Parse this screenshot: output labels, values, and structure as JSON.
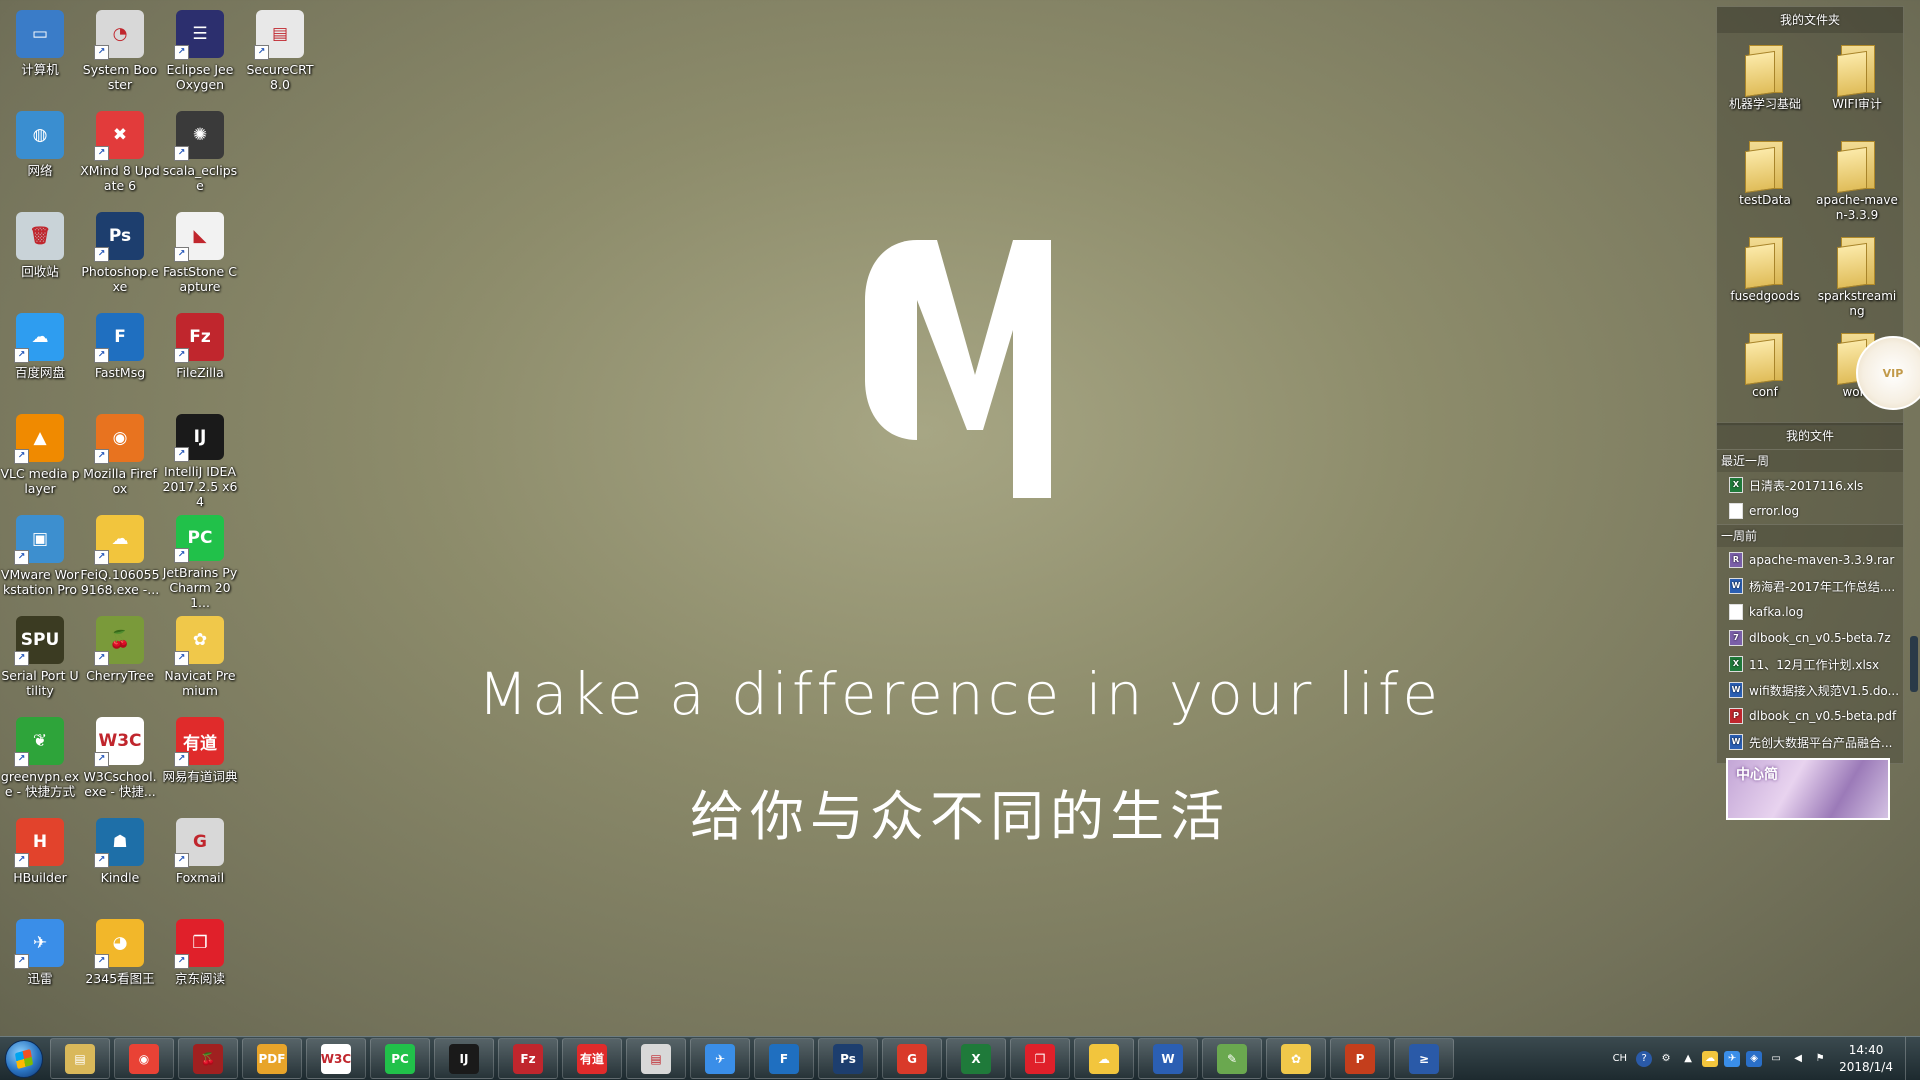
{
  "desktop": {
    "icons": [
      {
        "label": "计算机",
        "icon": "computer-icon",
        "bg": "#3a7cc8",
        "glyph": "▭",
        "shortcut": false
      },
      {
        "label": "System Booster",
        "icon": "system-booster-icon",
        "bg": "#d8d8d8",
        "glyph": "◔",
        "shortcut": true
      },
      {
        "label": "Eclipse Jee Oxygen",
        "icon": "eclipse-icon",
        "bg": "#2c2f6e",
        "glyph": "☰",
        "shortcut": true
      },
      {
        "label": "SecureCRT 8.0",
        "icon": "securecrt-icon",
        "bg": "#e8e8e8",
        "glyph": "▤",
        "shortcut": true
      },
      {
        "label": "网络",
        "icon": "network-icon",
        "bg": "#3a8ed0",
        "glyph": "◍",
        "shortcut": false
      },
      {
        "label": "XMind 8 Update 6",
        "icon": "xmind-icon",
        "bg": "#e23b3b",
        "glyph": "✖",
        "shortcut": true
      },
      {
        "label": "scala_eclipse",
        "icon": "scala-eclipse-icon",
        "bg": "#3a3a3a",
        "glyph": "✺",
        "shortcut": true
      },
      {
        "label": "",
        "icon": "",
        "bg": "",
        "glyph": "",
        "shortcut": false
      },
      {
        "label": "回收站",
        "icon": "recycle-bin-icon",
        "bg": "#c9d3d8",
        "glyph": "🗑",
        "shortcut": false
      },
      {
        "label": "Photoshop.exe",
        "icon": "photoshop-icon",
        "bg": "#1d3e6e",
        "glyph": "Ps",
        "shortcut": true
      },
      {
        "label": "FastStone Capture",
        "icon": "faststone-icon",
        "bg": "#f2f2f2",
        "glyph": "◣",
        "shortcut": true
      },
      {
        "label": "",
        "icon": "",
        "bg": "",
        "glyph": "",
        "shortcut": false
      },
      {
        "label": "百度网盘",
        "icon": "baidu-netdisk-icon",
        "bg": "#2e9df0",
        "glyph": "☁",
        "shortcut": true
      },
      {
        "label": "FastMsg",
        "icon": "fastmsg-icon",
        "bg": "#1f6fc0",
        "glyph": "F",
        "shortcut": true
      },
      {
        "label": "FileZilla",
        "icon": "filezilla-icon",
        "bg": "#c0262d",
        "glyph": "Fz",
        "shortcut": true
      },
      {
        "label": "",
        "icon": "",
        "bg": "",
        "glyph": "",
        "shortcut": false
      },
      {
        "label": "VLC media player",
        "icon": "vlc-icon",
        "bg": "#f08a00",
        "glyph": "▲",
        "shortcut": true
      },
      {
        "label": "Mozilla Firefox",
        "icon": "firefox-icon",
        "bg": "#e8731f",
        "glyph": "◉",
        "shortcut": true
      },
      {
        "label": "IntelliJ IDEA 2017.2.5 x64",
        "icon": "intellij-icon",
        "bg": "#1a1a1a",
        "glyph": "IJ",
        "shortcut": true
      },
      {
        "label": "",
        "icon": "",
        "bg": "",
        "glyph": "",
        "shortcut": false
      },
      {
        "label": "VMware Workstation Pro",
        "icon": "vmware-icon",
        "bg": "#3d8fcf",
        "glyph": "▣",
        "shortcut": true
      },
      {
        "label": "FeiQ.1060559168.exe -...",
        "icon": "feiq-icon",
        "bg": "#f2c53d",
        "glyph": "☁",
        "shortcut": true
      },
      {
        "label": "JetBrains PyCharm 201...",
        "icon": "pycharm-icon",
        "bg": "#21c14a",
        "glyph": "PC",
        "shortcut": true
      },
      {
        "label": "",
        "icon": "",
        "bg": "",
        "glyph": "",
        "shortcut": false
      },
      {
        "label": "Serial Port Utility",
        "icon": "serial-port-utility-icon",
        "bg": "#3b3b22",
        "glyph": "SPU",
        "shortcut": true
      },
      {
        "label": "CherryTree",
        "icon": "cherrytree-icon",
        "bg": "#7a9a3a",
        "glyph": "🍒",
        "shortcut": true
      },
      {
        "label": "Navicat Premium",
        "icon": "navicat-icon",
        "bg": "#f0c84a",
        "glyph": "✿",
        "shortcut": true
      },
      {
        "label": "",
        "icon": "",
        "bg": "",
        "glyph": "",
        "shortcut": false
      },
      {
        "label": "greenvpn.exe - 快捷方式",
        "icon": "greenvpn-icon",
        "bg": "#2ea43a",
        "glyph": "❦",
        "shortcut": true
      },
      {
        "label": "W3Cschool.exe - 快捷...",
        "icon": "w3cschool-icon",
        "bg": "#ffffff",
        "glyph": "W3C",
        "shortcut": true
      },
      {
        "label": "网易有道词典",
        "icon": "youdao-icon",
        "bg": "#e02b2b",
        "glyph": "有道",
        "shortcut": true
      },
      {
        "label": "",
        "icon": "",
        "bg": "",
        "glyph": "",
        "shortcut": false
      },
      {
        "label": "HBuilder",
        "icon": "hbuilder-icon",
        "bg": "#e2432c",
        "glyph": "H",
        "shortcut": true
      },
      {
        "label": "Kindle",
        "icon": "kindle-icon",
        "bg": "#1e6fa8",
        "glyph": "☗",
        "shortcut": true
      },
      {
        "label": "Foxmail",
        "icon": "foxmail-icon",
        "bg": "#d8d8d8",
        "glyph": "G",
        "shortcut": true
      },
      {
        "label": "",
        "icon": "",
        "bg": "",
        "glyph": "",
        "shortcut": false
      },
      {
        "label": "迅雷",
        "icon": "xunlei-icon",
        "bg": "#3a8ee8",
        "glyph": "✈",
        "shortcut": true
      },
      {
        "label": "2345看图王",
        "icon": "2345-viewer-icon",
        "bg": "#f2b72a",
        "glyph": "◕",
        "shortcut": true
      },
      {
        "label": "京东阅读",
        "icon": "jd-reader-icon",
        "bg": "#e0202a",
        "glyph": "❐",
        "shortcut": true
      }
    ]
  },
  "wallpaper": {
    "slogan_en": "Make a difference in your life",
    "slogan_cn": "给你与众不同的生活"
  },
  "fence_folders": {
    "title": "我的文件夹",
    "items": [
      {
        "label": "机器学习基础"
      },
      {
        "label": "WIFI审计"
      },
      {
        "label": "testData"
      },
      {
        "label": "apache-maven-3.3.9"
      },
      {
        "label": "fusedgoods"
      },
      {
        "label": "sparkstreaming"
      },
      {
        "label": "conf"
      },
      {
        "label": "work"
      }
    ]
  },
  "fence_files": {
    "title": "我的文件",
    "sections": [
      {
        "title": "最近一周",
        "files": [
          {
            "name": "日清表-2017116.xls",
            "type": "excel",
            "color": "#1f7a3a",
            "glyph": "X"
          },
          {
            "name": "error.log",
            "type": "log",
            "color": "#ffffff",
            "glyph": ""
          }
        ]
      },
      {
        "title": "一周前",
        "files": [
          {
            "name": "apache-maven-3.3.9.rar",
            "type": "rar",
            "color": "#7a5fa8",
            "glyph": "R"
          },
          {
            "name": "杨海君-2017年工作总结....",
            "type": "word",
            "color": "#2b5fb3",
            "glyph": "W"
          },
          {
            "name": "kafka.log",
            "type": "log",
            "color": "#ffffff",
            "glyph": ""
          },
          {
            "name": "dlbook_cn_v0.5-beta.7z",
            "type": "archive",
            "color": "#7a5fa8",
            "glyph": "7"
          },
          {
            "name": "11、12月工作计划.xlsx",
            "type": "excel",
            "color": "#1f7a3a",
            "glyph": "X"
          },
          {
            "name": "wifi数据接入规范V1.5.do...",
            "type": "word",
            "color": "#2b5fb3",
            "glyph": "W"
          },
          {
            "name": "dlbook_cn_v0.5-beta.pdf",
            "type": "pdf",
            "color": "#c0262d",
            "glyph": "P"
          },
          {
            "name": "先创大数据平台产品融合...",
            "type": "word",
            "color": "#2b5fb3",
            "glyph": "W"
          }
        ]
      }
    ],
    "thumb_text": "中心简"
  },
  "vip_badge": "VIP",
  "taskbar": {
    "apps": [
      {
        "name": "explorer",
        "bg": "#d9b85a",
        "glyph": "▤"
      },
      {
        "name": "chrome",
        "bg": "#e94235",
        "glyph": "◉"
      },
      {
        "name": "cherrytree",
        "bg": "#a02020",
        "glyph": "🍒"
      },
      {
        "name": "pdf",
        "bg": "#e8a42a",
        "glyph": "PDF"
      },
      {
        "name": "w3cschool",
        "bg": "#ffffff",
        "glyph": "W3C"
      },
      {
        "name": "pycharm",
        "bg": "#21c14a",
        "glyph": "PC"
      },
      {
        "name": "intellij",
        "bg": "#1a1a1a",
        "glyph": "IJ"
      },
      {
        "name": "filezilla",
        "bg": "#c0262d",
        "glyph": "Fz"
      },
      {
        "name": "youdao",
        "bg": "#e02b2b",
        "glyph": "有道"
      },
      {
        "name": "securecrt",
        "bg": "#d8d8d8",
        "glyph": "▤"
      },
      {
        "name": "xunlei",
        "bg": "#3a8ee8",
        "glyph": "✈"
      },
      {
        "name": "fastmsg",
        "bg": "#1f6fc0",
        "glyph": "F"
      },
      {
        "name": "photoshop",
        "bg": "#1d3e6e",
        "glyph": "Ps"
      },
      {
        "name": "foxmail",
        "bg": "#d93a2a",
        "glyph": "G"
      },
      {
        "name": "excel",
        "bg": "#1f7a3a",
        "glyph": "X"
      },
      {
        "name": "jd-reader",
        "bg": "#e0202a",
        "glyph": "❐"
      },
      {
        "name": "feiq",
        "bg": "#f2c53d",
        "glyph": "☁"
      },
      {
        "name": "word",
        "bg": "#2b5fb3",
        "glyph": "W"
      },
      {
        "name": "notepad",
        "bg": "#6aa84f",
        "glyph": "✎"
      },
      {
        "name": "navicat",
        "bg": "#f0c84a",
        "glyph": "✿"
      },
      {
        "name": "powerpoint",
        "bg": "#c43e1c",
        "glyph": "P"
      },
      {
        "name": "powershell",
        "bg": "#2a5aa8",
        "glyph": "≥"
      }
    ],
    "tray_lang": "CH",
    "time": "14:40",
    "date": "2018/1/4"
  }
}
